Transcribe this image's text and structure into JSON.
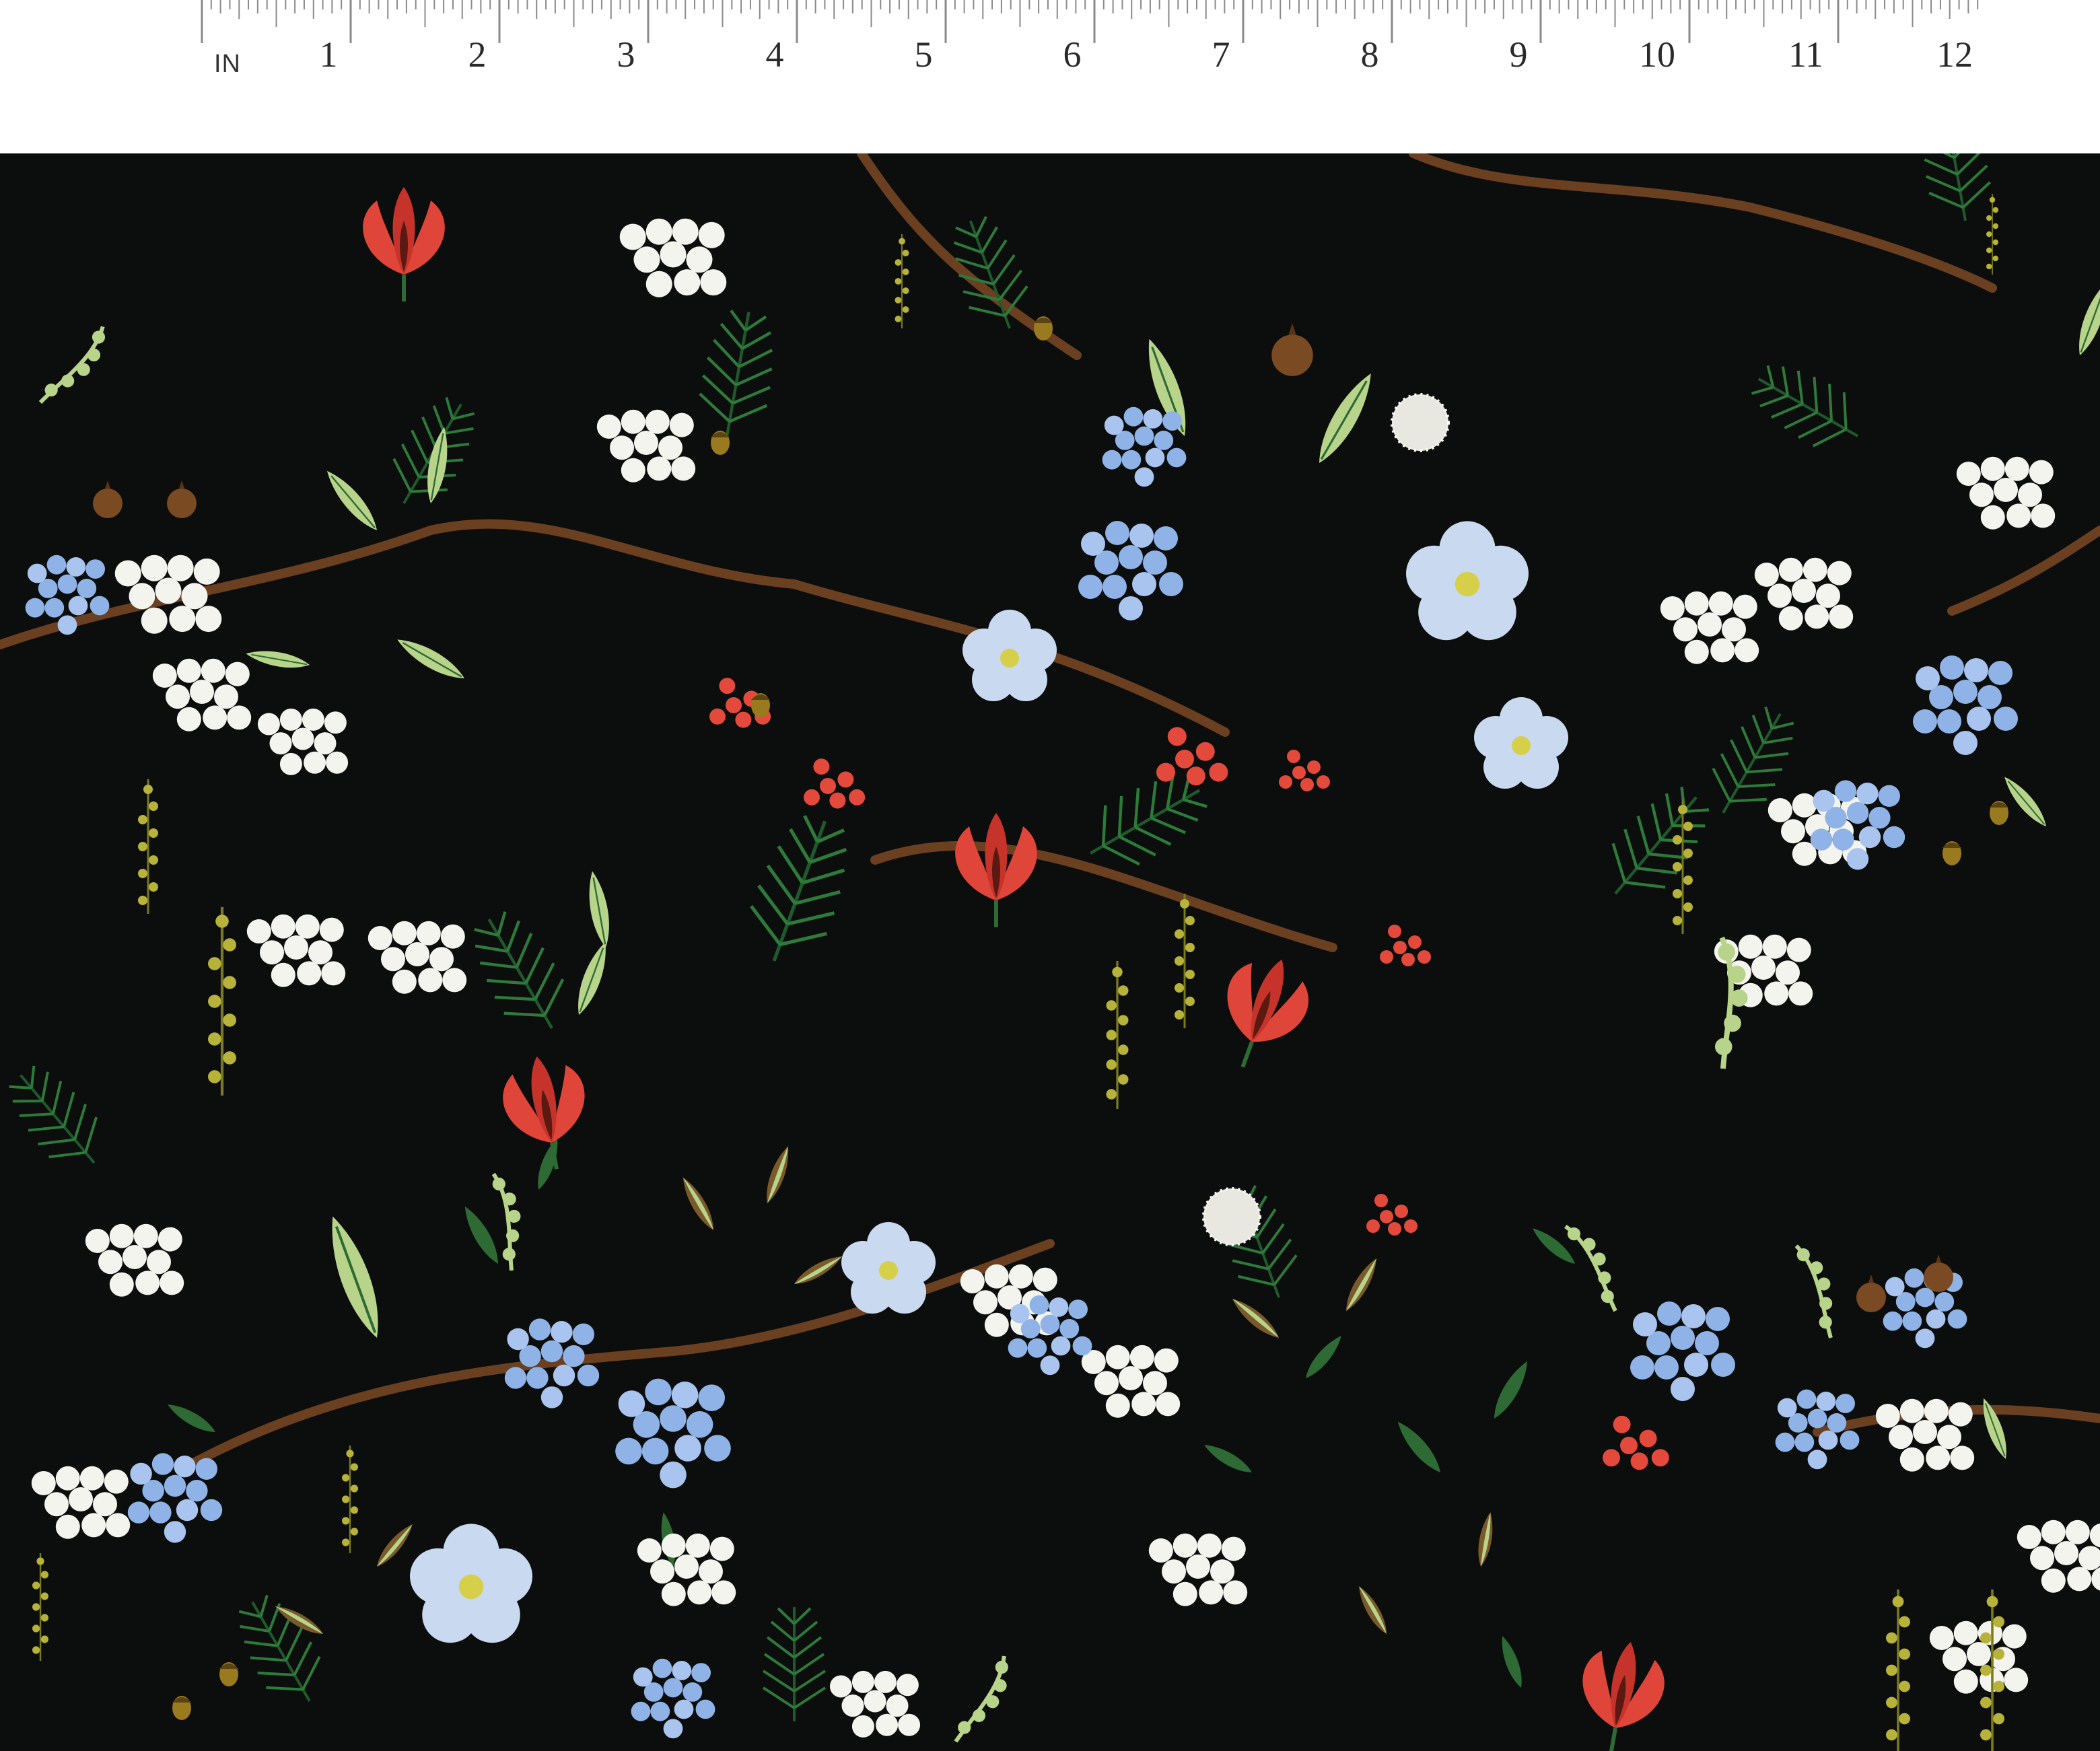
{
  "ruler": {
    "unit_label": "IN",
    "numbers": [
      "1",
      "2",
      "3",
      "4",
      "5",
      "6",
      "7",
      "8",
      "9",
      "10",
      "11",
      "12"
    ],
    "tick_color": "#8a8a8a",
    "text_color": "#2a2a2a"
  },
  "fabric": {
    "pattern": "botanical floral print",
    "background_color": "#0c0d0d",
    "palette": {
      "branch": "#6b4020",
      "pine": "#1f5a2c",
      "leaf_light": "#b7d48a",
      "leaf_dark": "#2e6b34",
      "red": "#e0453a",
      "berry": "#e34a3c",
      "white": "#f4f4ee",
      "blue": "#8fb3e6",
      "pale_blue": "#c9d9ef",
      "mustard": "#b7b33a",
      "acorn": "#9a7a1e",
      "pod": "#7a4a22"
    }
  }
}
